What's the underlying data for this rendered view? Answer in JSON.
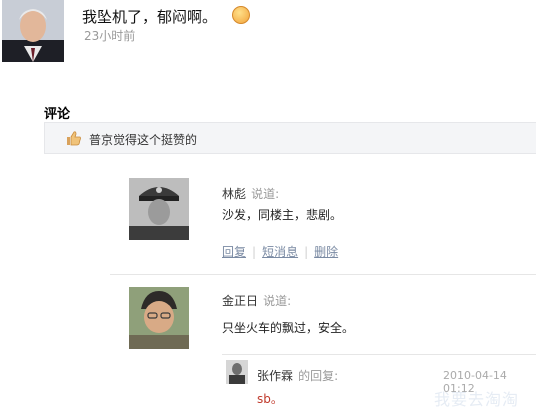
{
  "post": {
    "text": "我坠机了，郁闷啊。",
    "time": "23小时前",
    "emoji_icon": "smile-emoji-icon"
  },
  "comments_section": {
    "title": "评论",
    "likes_text": "普京觉得这个挺赞的"
  },
  "comments": [
    {
      "author": "林彪",
      "said_label": "说道:",
      "text": "沙发，同楼主，悲剧。",
      "actions": [
        "回复",
        "短消息",
        "删除"
      ]
    },
    {
      "author": "金正日",
      "said_label": "说道:",
      "text": "只坐火车的飘过，安全。",
      "reply": {
        "author": "张作霖",
        "tag": "的回复:",
        "time": "2010-04-14 01:12",
        "text": "sb。"
      }
    }
  ],
  "watermark": "我要去淘淘"
}
